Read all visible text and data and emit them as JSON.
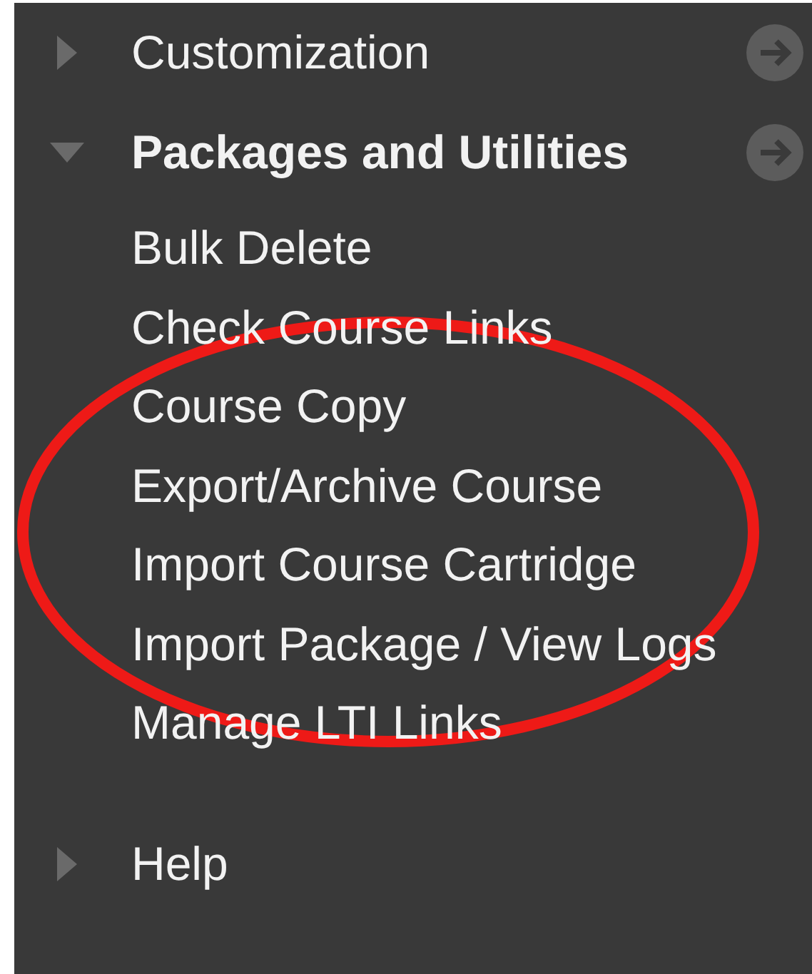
{
  "sections": [
    {
      "label": "Customization",
      "expanded": false,
      "go_button": true
    },
    {
      "label": "Packages and Utilities",
      "expanded": true,
      "go_button": true,
      "children": [
        {
          "label": "Bulk Delete"
        },
        {
          "label": "Check Course Links"
        },
        {
          "label": "Course Copy"
        },
        {
          "label": "Export/Archive Course"
        },
        {
          "label": "Import Course Cartridge"
        },
        {
          "label": "Import Package / View Logs"
        },
        {
          "label": "Manage LTI Links"
        }
      ]
    },
    {
      "label": "Help",
      "expanded": false,
      "go_button": false
    }
  ]
}
